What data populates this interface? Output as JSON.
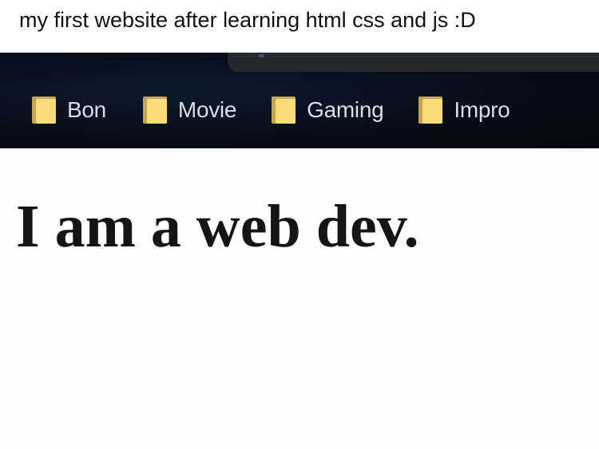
{
  "post": {
    "caption": "my first website after learning html css and js :D"
  },
  "bookmarks_bar": {
    "items": [
      {
        "label": "Bon",
        "icon": "folder-icon"
      },
      {
        "label": "Movie",
        "icon": "folder-icon"
      },
      {
        "label": "Gaming",
        "icon": "folder-icon"
      },
      {
        "label": "Impro",
        "icon": "folder-icon"
      }
    ]
  },
  "page": {
    "heading": "I am a web dev."
  },
  "colors": {
    "bar_background": "#070d18",
    "folder_front": "#f7dc79",
    "folder_back": "#c9a645",
    "bookmark_text": "#d8dde6",
    "heading_text": "#151515"
  }
}
